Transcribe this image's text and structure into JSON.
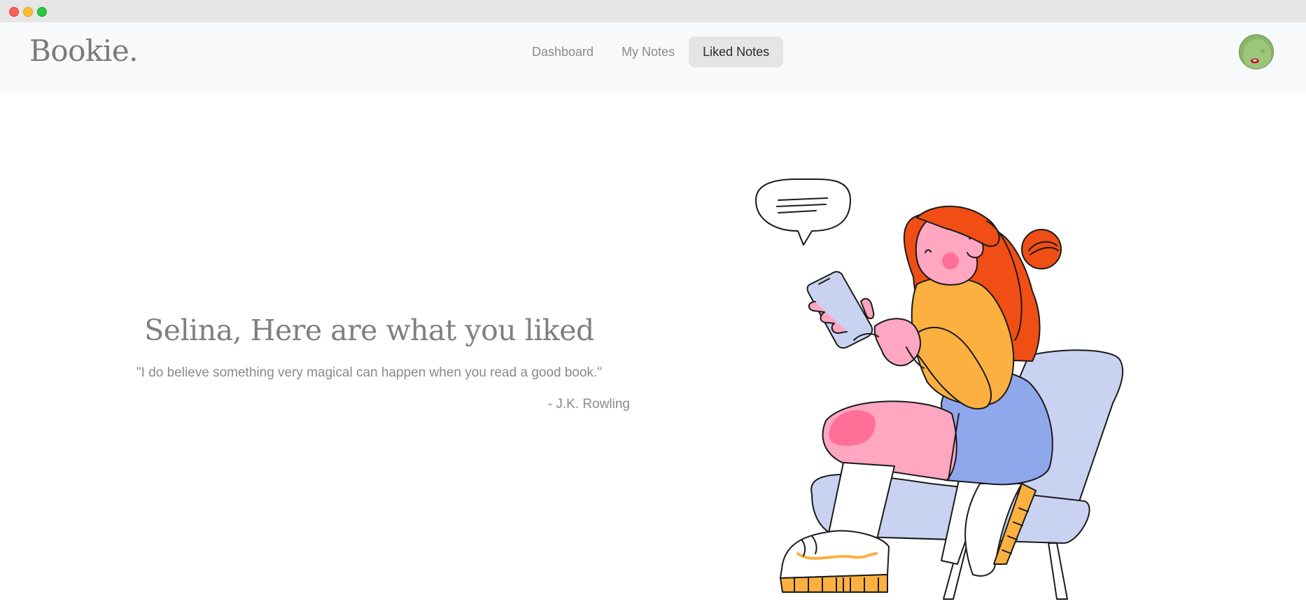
{
  "window": {
    "controls": [
      "close",
      "minimize",
      "maximize"
    ]
  },
  "navbar": {
    "brand": "Bookie.",
    "items": [
      {
        "label": "Dashboard",
        "active": false
      },
      {
        "label": "My Notes",
        "active": false
      },
      {
        "label": "Liked Notes",
        "active": true
      }
    ]
  },
  "hero": {
    "title": "Selina, Here are what you liked",
    "quote": "\"I do believe something very magical can happen when you read a good book.\"",
    "author": "- J.K. Rowling"
  },
  "colors": {
    "hair": "#f04e14",
    "skin": "#ffa6c1",
    "sweater": "#fbb040",
    "chair": "#c9d3f1",
    "skirt": "#8fa8ec",
    "navbar_bg": "#f8f9fa",
    "active_nav_bg": "#e4e5e7"
  }
}
